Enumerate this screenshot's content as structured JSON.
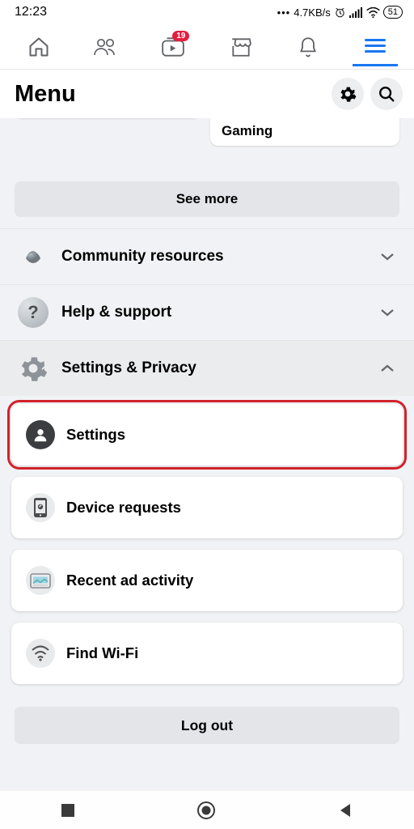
{
  "status": {
    "time": "12:23",
    "net": "4.7KB/s",
    "battery": "51"
  },
  "tabbar": {
    "watch_badge": "19"
  },
  "header": {
    "title": "Menu"
  },
  "shortcuts": {
    "gaming": "Gaming",
    "see_more": "See more"
  },
  "sections": {
    "community": "Community resources",
    "help": "Help & support",
    "settings_privacy": "Settings & Privacy"
  },
  "sub": {
    "settings": "Settings",
    "device": "Device requests",
    "recent_ad": "Recent ad activity",
    "wifi": "Find Wi-Fi"
  },
  "logout": "Log out"
}
